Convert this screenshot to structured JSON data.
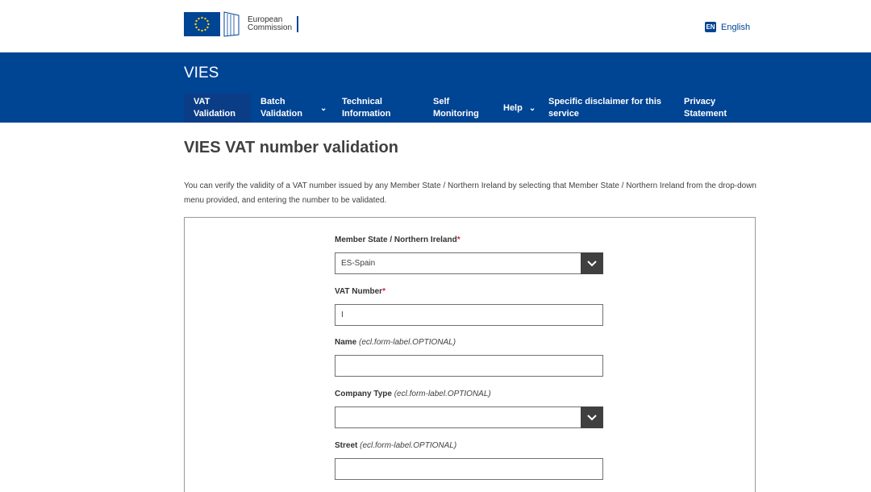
{
  "header": {
    "logo_line1": "European",
    "logo_line2": "Commission",
    "language_code": "EN",
    "language_label": "English",
    "site_name": "VIES"
  },
  "nav": [
    {
      "label_line1": "VAT",
      "label_line2": "Validation",
      "active": true
    },
    {
      "label_line1": "Batch",
      "label_line2": "Validation",
      "has_chevron": true
    },
    {
      "label_line1": "Technical",
      "label_line2": "Information"
    },
    {
      "label_line1": "Self",
      "label_line2": "Monitoring"
    },
    {
      "label_line1": "Help",
      "label_line2": "",
      "has_chevron": true
    },
    {
      "label_line1": "Specific disclaimer for this",
      "label_line2": "service"
    },
    {
      "label_line1": "Privacy",
      "label_line2": "Statement"
    }
  ],
  "page": {
    "title": "VIES VAT number validation",
    "intro": "You can verify the validity of a VAT number issued by any Member State / Northern Ireland by selecting that Member State / Northern Ireland from the drop-down menu provided, and entering the number to be validated."
  },
  "form": {
    "member_state_label": "Member State / Northern Ireland",
    "member_state_value": "ES-Spain",
    "vat_label": "VAT Number",
    "vat_value": "I",
    "name_label": "Name",
    "company_type_label": "Company Type",
    "street_label": "Street",
    "optional_text": "(ecl.form-label.OPTIONAL)",
    "required_mark": "*"
  }
}
